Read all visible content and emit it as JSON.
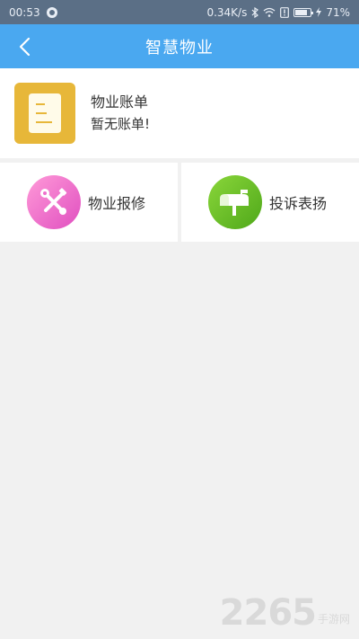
{
  "status_bar": {
    "time": "00:53",
    "network_speed": "0.34K/s",
    "battery_percent": "71%",
    "battery_level": 0.71
  },
  "nav": {
    "title": "智慧物业"
  },
  "bill": {
    "title": "物业账单",
    "subtitle": "暂无账单!"
  },
  "services": [
    {
      "label": "物业报修",
      "icon": "wrench-screwdriver-icon"
    },
    {
      "label": "投诉表扬",
      "icon": "mailbox-icon"
    }
  ],
  "watermark": {
    "number": "2265",
    "text": "手游网"
  },
  "colors": {
    "status_bar": "#5b6f86",
    "nav_bar": "#4aa8f0",
    "bill_icon": "#e7b739",
    "repair_gradient": [
      "#ff9ad8",
      "#e04fc0"
    ],
    "complaint_gradient": [
      "#8ad63a",
      "#4fa81a"
    ]
  }
}
